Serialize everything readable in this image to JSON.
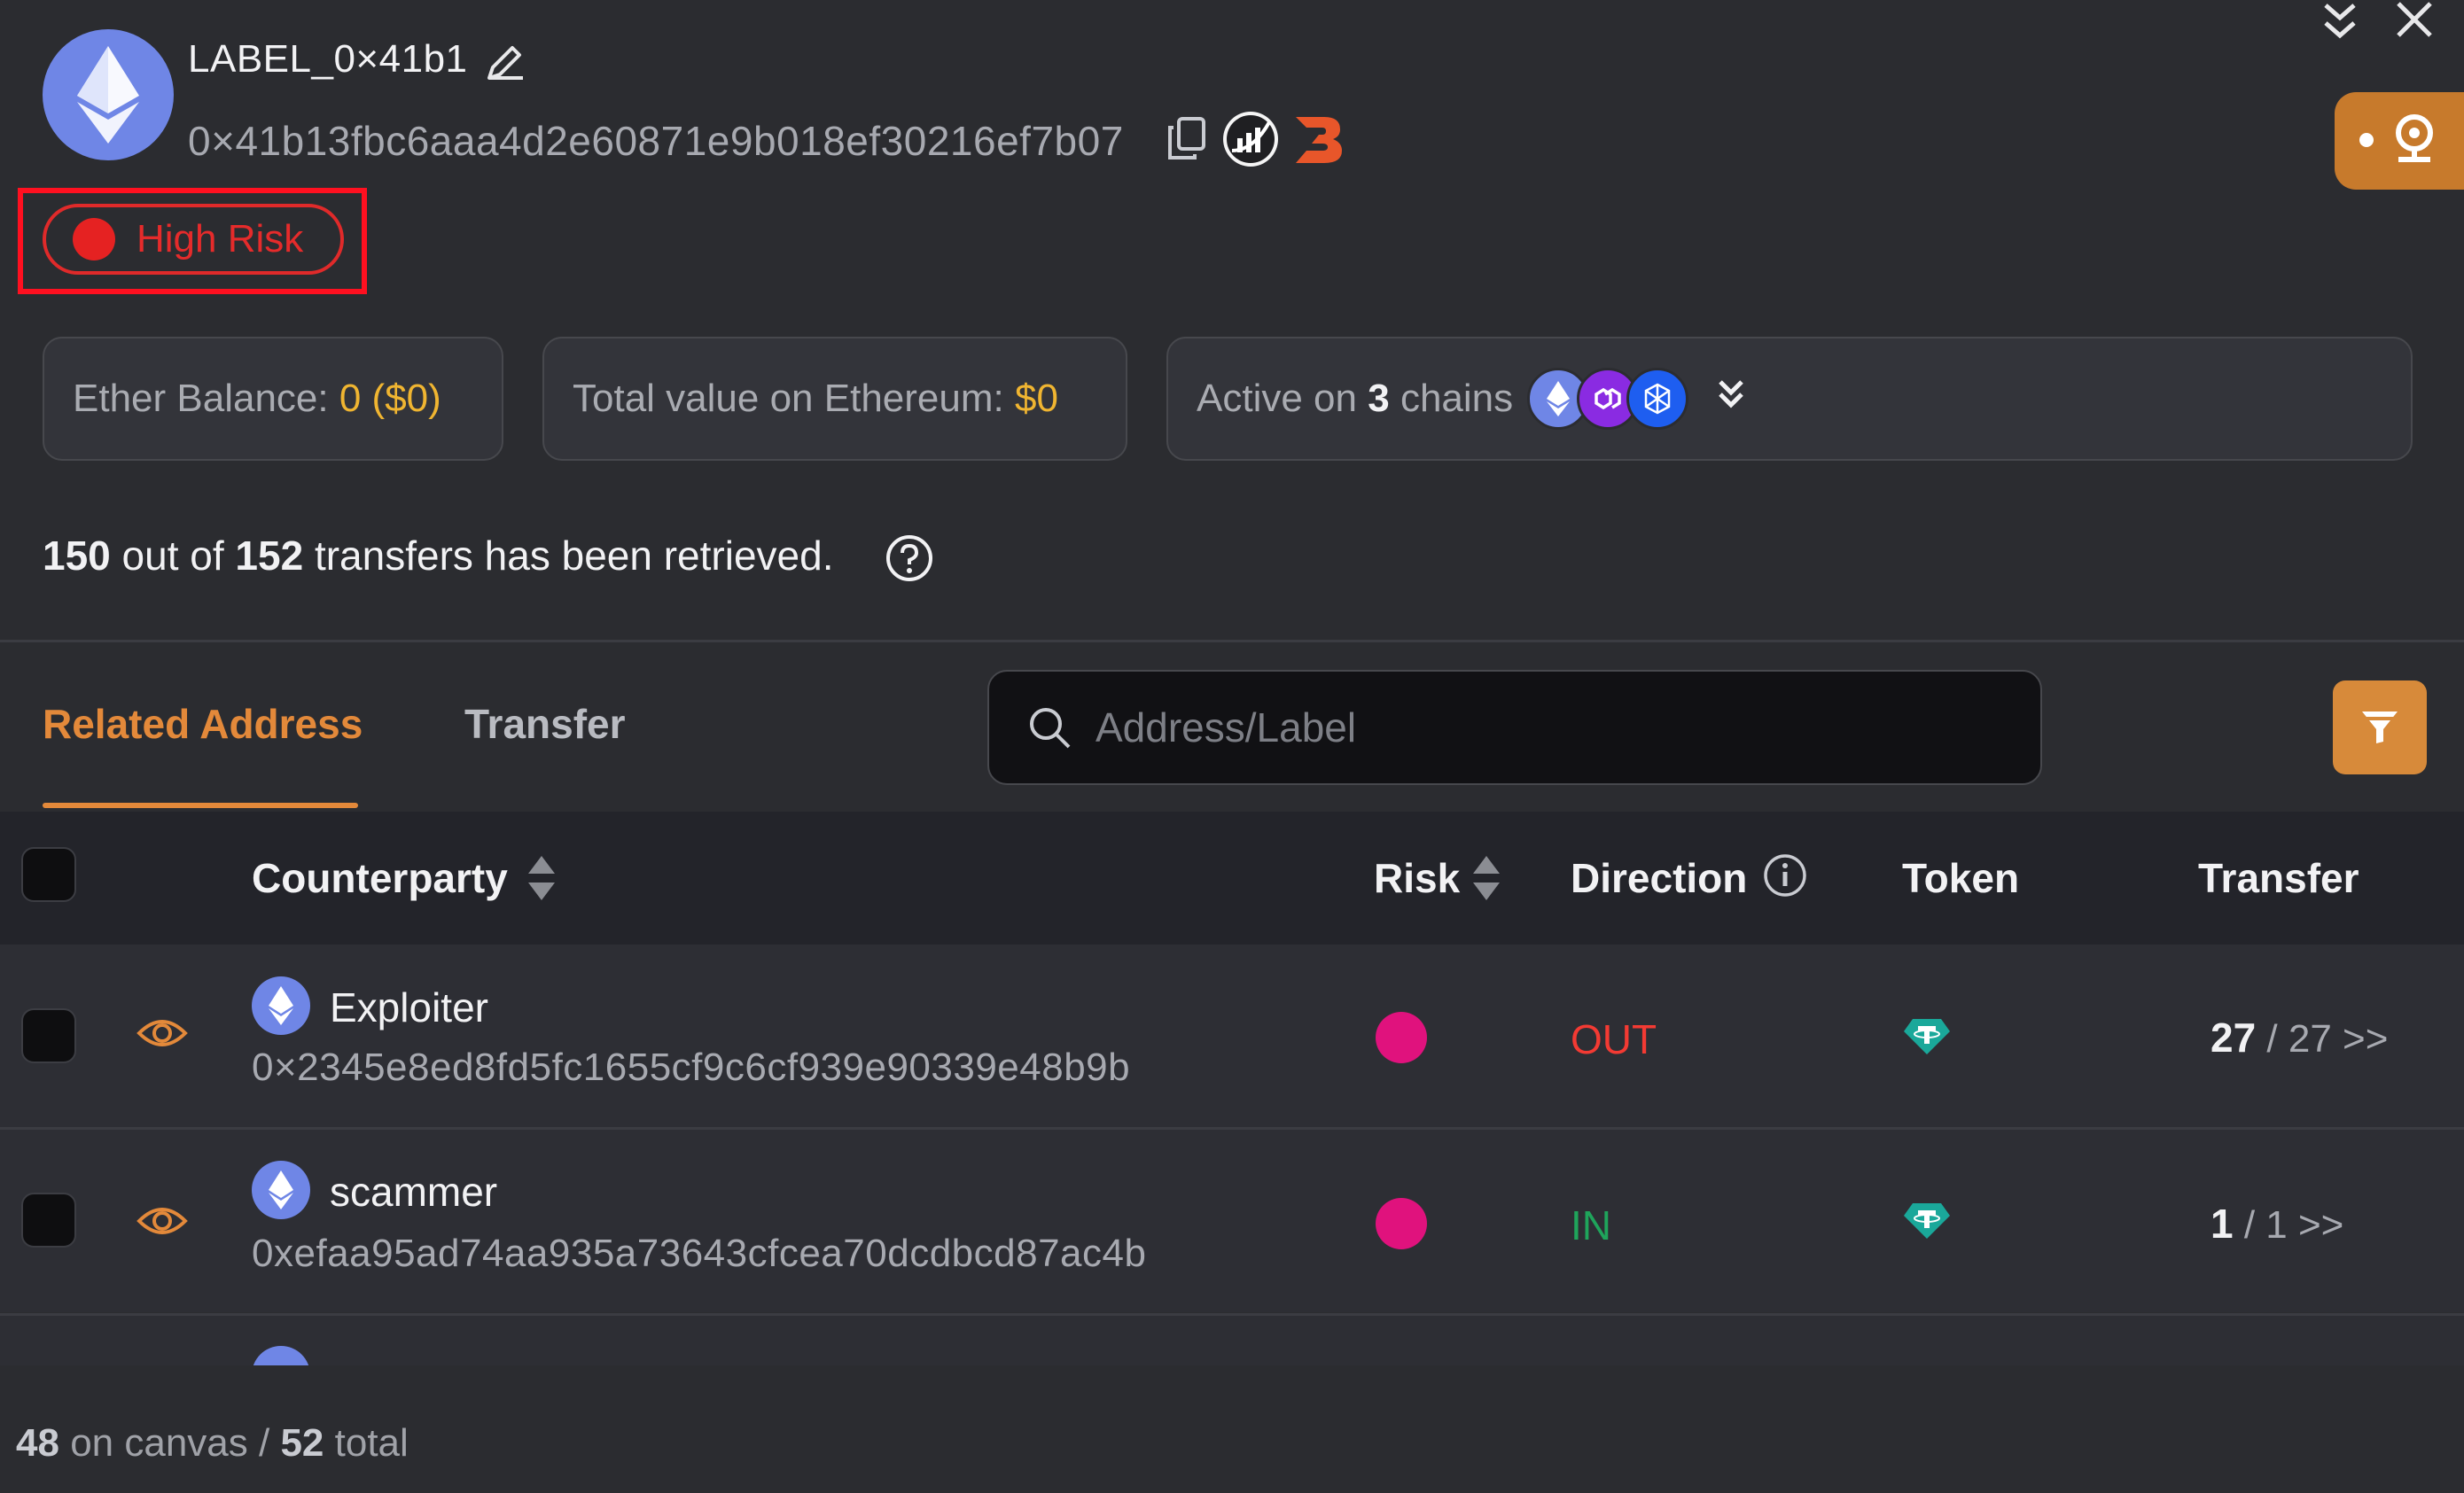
{
  "header": {
    "label": "LABEL_0×41b1",
    "address": "0×41b13fbc6aaa4d2e60871e9b018ef30216ef7b07",
    "risk": "High Risk"
  },
  "stats": {
    "ether_balance_label": "Ether Balance:",
    "ether_balance_value": "0 ($0)",
    "total_value_label": "Total value on Ethereum:",
    "total_value_value": "$0",
    "active_prefix": "Active on",
    "active_count": "3",
    "active_suffix": "chains"
  },
  "retrieved": {
    "retrieved_count": "150",
    "out_of": "out of",
    "total_count": "152",
    "suffix": "transfers has been retrieved."
  },
  "tabs": [
    {
      "label": "Related Address"
    },
    {
      "label": "Transfer"
    }
  ],
  "search": {
    "placeholder": "Address/Label"
  },
  "table": {
    "headers": {
      "counterparty": "Counterparty",
      "risk": "Risk",
      "direction": "Direction",
      "token": "Token",
      "transfer": "Transfer"
    },
    "rows": [
      {
        "name": "Exploiter",
        "address": "0×2345e8ed8fd5fc1655cf9c6cf939e90339e48b9b",
        "direction": "OUT",
        "transfer_shown": "27",
        "transfer_total": "/ 27 >>"
      },
      {
        "name": "scammer",
        "address": "0xefaa95ad74aa935a73643cfcea70dcdbcd87ac4b",
        "direction": "IN",
        "transfer_shown": "1",
        "transfer_total": "/ 1 >>"
      }
    ]
  },
  "footer": {
    "on_canvas": "48",
    "on_canvas_label": "on canvas /",
    "total": "52",
    "total_label": "total"
  },
  "colors": {
    "accent": "#e3893a",
    "risk_red": "#e52b2b",
    "value_yellow": "#f0b531",
    "out_red": "#f33a33",
    "in_green": "#1fa45b",
    "risk_magenta": "#e0127d"
  }
}
